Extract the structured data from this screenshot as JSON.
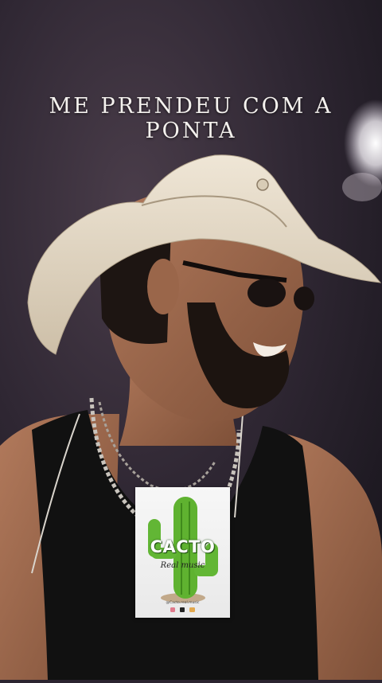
{
  "overlay": {
    "caption": "ME PRENDEU COM A PONTA"
  },
  "logo": {
    "word": "CACTO",
    "subtitle": "Real music",
    "handle": "@Cacto.real.music",
    "social_icons": [
      "instagram-icon",
      "tiktok-icon",
      "youtube-icon"
    ]
  },
  "colors": {
    "background": "#2b2430",
    "caption_text": "#f4f1ee",
    "cactus_green": "#5fb230",
    "hat_straw": "#e6dccb",
    "tank_top": "#111111"
  }
}
